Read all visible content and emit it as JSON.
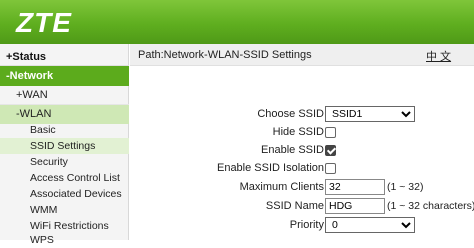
{
  "header": {
    "logo": "ZTE"
  },
  "sidebar": {
    "status": "+Status",
    "network": "-Network",
    "wan": "+WAN",
    "wlan": "-WLAN",
    "items": [
      "Basic",
      "SSID Settings",
      "Security",
      "Access Control List",
      "Associated Devices",
      "WMM",
      "WiFi Restrictions",
      "WPS"
    ],
    "active_item": "SSID Settings"
  },
  "content": {
    "path": "Path:Network-WLAN-SSID Settings",
    "lang": "中 文",
    "form": {
      "choose_ssid_label": "Choose SSID",
      "choose_ssid_value": "SSID1",
      "hide_ssid_label": "Hide SSID",
      "hide_ssid_checked": false,
      "enable_ssid_label": "Enable SSID",
      "enable_ssid_checked": true,
      "enable_isolation_label": "Enable SSID Isolation",
      "enable_isolation_checked": false,
      "max_clients_label": "Maximum Clients",
      "max_clients_value": "32",
      "max_clients_hint": "(1 ~ 32)",
      "ssid_name_label": "SSID Name",
      "ssid_name_value": "HDG",
      "ssid_name_hint": "(1 ~ 32 characters)",
      "priority_label": "Priority",
      "priority_value": "0"
    }
  },
  "colors": {
    "header_green": "#5fae1f",
    "active_nav": "#5cab1c",
    "wlan_bg": "#cfe8b5"
  }
}
